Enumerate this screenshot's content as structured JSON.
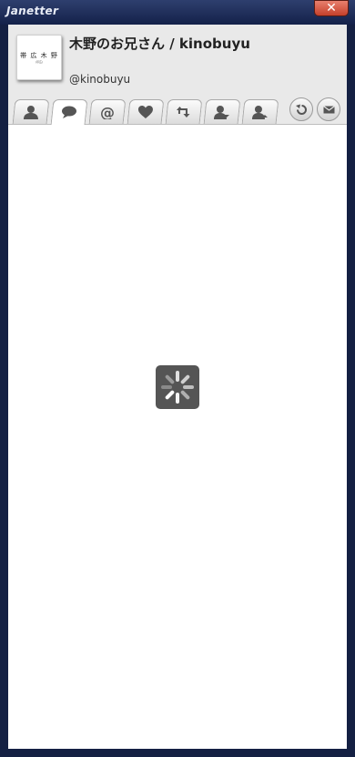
{
  "window": {
    "app_title": "Janetter",
    "close_glyph": "✕"
  },
  "profile": {
    "avatar_text": "帯 広 木 野",
    "avatar_subtext": "(帯広) ",
    "display_name": "木野のお兄さん / kinobuyu",
    "handle": "@kinobuyu"
  },
  "tabs": [
    {
      "icon": "user-icon",
      "active": false
    },
    {
      "icon": "speech-bubble-icon",
      "active": true
    },
    {
      "icon": "at-icon",
      "active": false
    },
    {
      "icon": "heart-icon",
      "active": false
    },
    {
      "icon": "retweet-icon",
      "active": false
    },
    {
      "icon": "followers-icon",
      "active": false
    },
    {
      "icon": "following-icon",
      "active": false
    }
  ],
  "actions": [
    {
      "icon": "reply-icon"
    },
    {
      "icon": "mail-icon"
    }
  ],
  "loading": {
    "icon": "spinner-icon"
  },
  "colors": {
    "frame": "#142043",
    "header_bg": "#e9e9e9",
    "icon": "#555555"
  }
}
